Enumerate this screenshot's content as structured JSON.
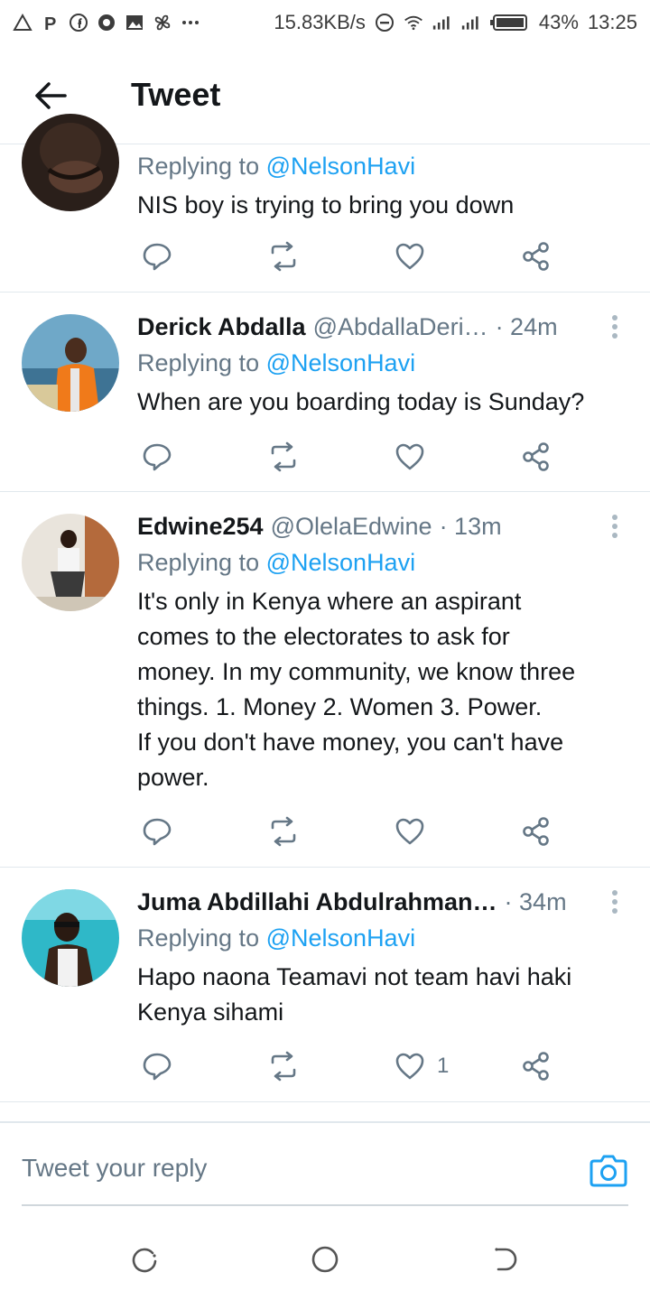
{
  "status_bar": {
    "network_speed": "15.83KB/s",
    "battery": "43%",
    "time": "13:25"
  },
  "header": {
    "title": "Tweet"
  },
  "tweets": [
    {
      "name": "",
      "handle": "",
      "time": "",
      "replying_prefix": "Replying to",
      "replying_to": "@NelsonHavi",
      "text": "NIS boy is trying to bring you down",
      "likes": ""
    },
    {
      "name": "Derick Abdalla",
      "handle": "@AbdallaDeri…",
      "time": "· 24m",
      "replying_prefix": "Replying to",
      "replying_to": "@NelsonHavi",
      "text": "When are you boarding today is Sunday?",
      "likes": ""
    },
    {
      "name": "Edwine254",
      "handle": "@OlelaEdwine",
      "time": "· 13m",
      "replying_prefix": "Replying to",
      "replying_to": "@NelsonHavi",
      "text_lines": [
        "It's only in Kenya where an aspirant",
        "comes to the electorates to ask for",
        "money. In my community, we know three",
        "things. 1. Money 2. Women 3. Power.",
        "If you don't have money, you can't have",
        "power."
      ],
      "likes": ""
    },
    {
      "name": "Juma Abdillahi Abdulrahman…",
      "handle": "",
      "time": "· 34m",
      "replying_prefix": "Replying to",
      "replying_to": "@NelsonHavi",
      "text_lines": [
        "Hapo naona Teamavi not team havi haki",
        "Kenya sihami"
      ],
      "likes": "1"
    }
  ],
  "reply_bar": {
    "placeholder": "Tweet your reply"
  },
  "icons": {
    "accent": "#1da1f2",
    "muted": "#657786"
  }
}
